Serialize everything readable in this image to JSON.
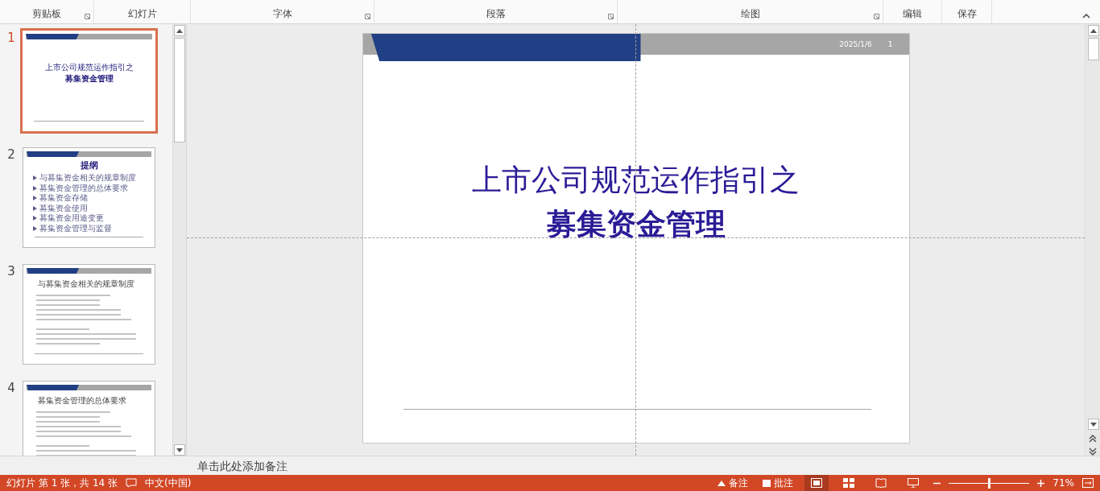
{
  "ribbon": {
    "groups": [
      {
        "label": "剪贴板",
        "launcher": true
      },
      {
        "label": "幻灯片",
        "launcher": false
      },
      {
        "label": "字体",
        "launcher": true
      },
      {
        "label": "段落",
        "launcher": true
      },
      {
        "label": "绘图",
        "launcher": true
      },
      {
        "label": "编辑",
        "launcher": false
      },
      {
        "label": "保存",
        "launcher": false
      }
    ]
  },
  "thumbnails": [
    {
      "number": "1",
      "selected": true,
      "kind": "title",
      "title": "上市公司规范运作指引之",
      "subtitle": "募集资金管理"
    },
    {
      "number": "2",
      "selected": false,
      "kind": "outline",
      "heading": "提纲",
      "items": [
        "与募集资金相关的规章制度",
        "募集资金管理的总体要求",
        "募集资金存储",
        "募集资金使用",
        "募集资金用途变更",
        "募集资金管理与监督"
      ]
    },
    {
      "number": "3",
      "selected": false,
      "kind": "body",
      "heading": "与募集资金相关的规章制度"
    },
    {
      "number": "4",
      "selected": false,
      "kind": "body",
      "heading": "募集资金管理的总体要求"
    }
  ],
  "slide": {
    "date": "2025/1/6",
    "number": "1",
    "title_lines": [
      "上市公司规范运作指引之",
      "募集资金管理"
    ]
  },
  "notes": {
    "placeholder": "单击此处添加备注"
  },
  "status_bar": {
    "slide_info": "幻灯片 第 1 张，共 14 张",
    "language": "中文(中国)",
    "notes_button": "备注",
    "comments_button": "批注",
    "views": [
      {
        "kind": "normal",
        "selected": true
      },
      {
        "kind": "sorter",
        "selected": false
      },
      {
        "kind": "reading",
        "selected": false
      },
      {
        "kind": "slideshow",
        "selected": false
      }
    ],
    "zoom": {
      "level": 0.5,
      "reading": "71%"
    }
  }
}
